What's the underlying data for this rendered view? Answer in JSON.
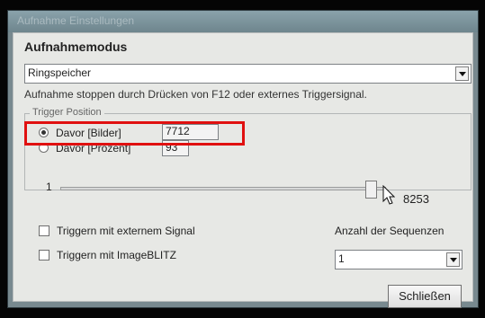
{
  "window": {
    "title": "Aufnahme Einstellungen"
  },
  "section": {
    "title": "Aufnahmemodus"
  },
  "mode_combo": {
    "value": "Ringspeicher"
  },
  "description": "Aufnahme stoppen durch Drücken von F12 oder externes Triggersignal.",
  "trigger_group": {
    "label": "Trigger Position",
    "option_frames": {
      "label": "Davor [Bilder]",
      "value": "7712",
      "selected": true
    },
    "option_percent": {
      "label": "Davor [Prozent]",
      "value": "93",
      "selected": false
    },
    "slider": {
      "min_label": "1",
      "max_label": "8253",
      "value": 7712
    }
  },
  "checkboxes": {
    "external_signal": {
      "label": "Triggern mit externem Signal",
      "checked": false
    },
    "imageblitz": {
      "label": "Triggern mit ImageBLITZ",
      "checked": false
    }
  },
  "sequences": {
    "label": "Anzahl der Sequenzen",
    "value": "1"
  },
  "close_button": {
    "label": "Schließen"
  },
  "colors": {
    "highlight": "#e01010"
  }
}
